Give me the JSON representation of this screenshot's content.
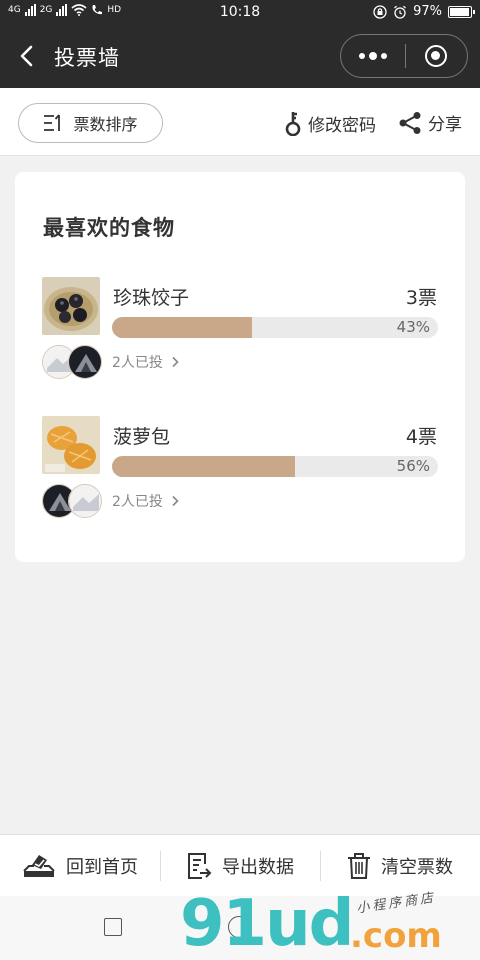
{
  "status_bar": {
    "net1": "4G",
    "net2": "2G",
    "hd": "HD",
    "time": "10:18",
    "battery": "97%"
  },
  "navbar": {
    "title": "投票墙"
  },
  "toolbar": {
    "sort_label": "票数排序",
    "change_password_label": "修改密码",
    "share_label": "分享"
  },
  "poll": {
    "title": "最喜欢的食物",
    "options": [
      {
        "name": "珍珠饺子",
        "votes": "3票",
        "percent": "43%",
        "fill": 0.43,
        "voters_text": "2人已投"
      },
      {
        "name": "菠萝包",
        "votes": "4票",
        "percent": "56%",
        "fill": 0.56,
        "voters_text": "2人已投"
      }
    ]
  },
  "bottom_bar": {
    "home_label": "回到首页",
    "export_label": "导出数据",
    "clear_label": "清空票数"
  },
  "watermark": {
    "brand": "91ud",
    "domain": ".com",
    "handwritten": "小程序商店"
  },
  "colors": {
    "bar_fill": "#c9a88a",
    "header_bg": "#2b2b2b",
    "watermark_teal": "#3fc0c0",
    "watermark_orange": "#f2a23a"
  },
  "icons": [
    "back-arrow-icon",
    "more-dots-icon",
    "close-target-icon",
    "sort-icon",
    "key-icon",
    "share-icon",
    "chevron-right-icon",
    "vote-box-icon",
    "export-doc-icon",
    "trash-icon"
  ]
}
